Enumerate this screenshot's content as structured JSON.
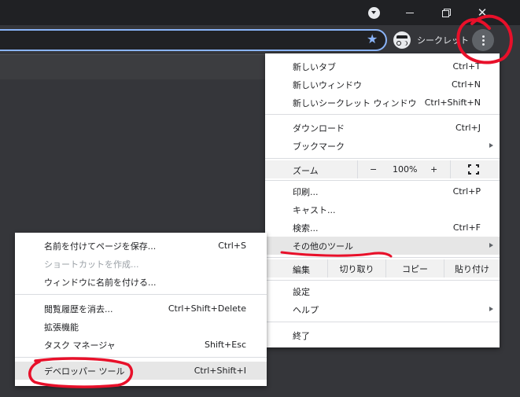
{
  "incognito": {
    "label": "シークレット"
  },
  "main_menu": {
    "new_tab": {
      "label": "新しいタブ",
      "shortcut": "Ctrl+T"
    },
    "new_window": {
      "label": "新しいウィンドウ",
      "shortcut": "Ctrl+N"
    },
    "new_incognito": {
      "label": "新しいシークレット ウィンドウ",
      "shortcut": "Ctrl+Shift+N"
    },
    "downloads": {
      "label": "ダウンロード",
      "shortcut": "Ctrl+J"
    },
    "bookmarks": {
      "label": "ブックマーク"
    },
    "zoom": {
      "label": "ズーム",
      "minus": "−",
      "value": "100%",
      "plus": "+"
    },
    "print": {
      "label": "印刷...",
      "shortcut": "Ctrl+P"
    },
    "cast": {
      "label": "キャスト..."
    },
    "find": {
      "label": "検索...",
      "shortcut": "Ctrl+F"
    },
    "more_tools": {
      "label": "その他のツール"
    },
    "edit": {
      "label": "編集",
      "cut": "切り取り",
      "copy": "コピー",
      "paste": "貼り付け"
    },
    "settings": {
      "label": "設定"
    },
    "help": {
      "label": "ヘルプ"
    },
    "exit": {
      "label": "終了"
    }
  },
  "sub_menu": {
    "save_page": {
      "label": "名前を付けてページを保存...",
      "shortcut": "Ctrl+S"
    },
    "create_shortcut": {
      "label": "ショートカットを作成..."
    },
    "name_window": {
      "label": "ウィンドウに名前を付ける..."
    },
    "clear_history": {
      "label": "閲覧履歴を消去...",
      "shortcut": "Ctrl+Shift+Delete"
    },
    "extensions": {
      "label": "拡張機能"
    },
    "task_manager": {
      "label": "タスク マネージャ",
      "shortcut": "Shift+Esc"
    },
    "dev_tools": {
      "label": "デベロッパー ツール",
      "shortcut": "Ctrl+Shift+I"
    }
  },
  "colors": {
    "annotation": "#e8102a",
    "accent": "#8ab4f8",
    "titlebar": "#202124"
  }
}
